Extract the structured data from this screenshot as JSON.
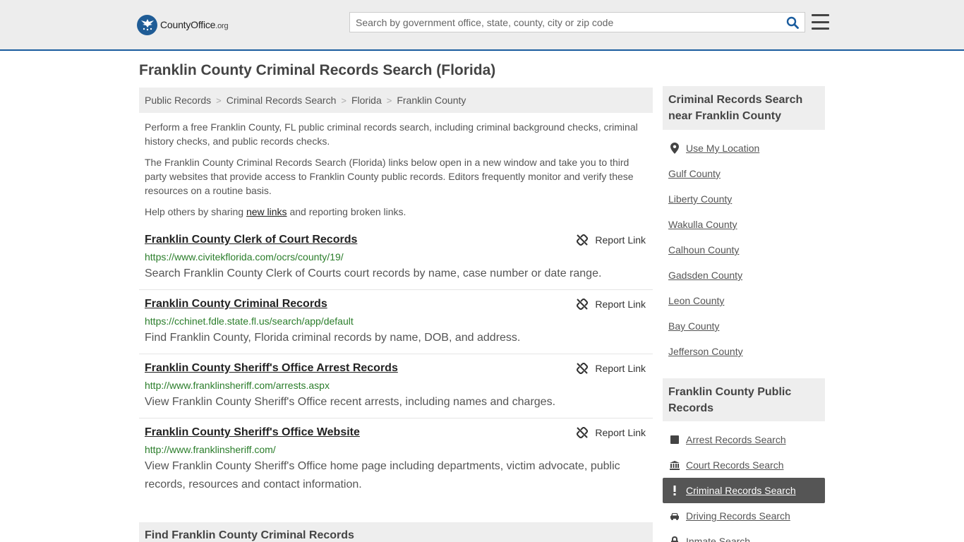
{
  "header": {
    "logo_main": "CountyOffice",
    "logo_tld": ".org",
    "search_placeholder": "Search by government office, state, county, city or zip code"
  },
  "page_title": "Franklin County Criminal Records Search (Florida)",
  "breadcrumb": [
    "Public Records",
    "Criminal Records Search",
    "Florida",
    "Franklin County"
  ],
  "intro": {
    "p1": "Perform a free Franklin County, FL public criminal records search, including criminal background checks, criminal history checks, and public records checks.",
    "p2": "The Franklin County Criminal Records Search (Florida) links below open in a new window and take you to third party websites that provide access to Franklin County public records. Editors frequently monitor and verify these resources on a routine basis.",
    "p3_before": "Help others by sharing ",
    "p3_link": "new links",
    "p3_after": " and reporting broken links."
  },
  "report_label": "Report Link",
  "links": [
    {
      "title": "Franklin County Clerk of Court Records",
      "url": "https://www.civitekflorida.com/ocrs/county/19/",
      "desc": "Search Franklin County Clerk of Courts court records by name, case number or date range."
    },
    {
      "title": "Franklin County Criminal Records",
      "url": "https://cchinet.fdle.state.fl.us/search/app/default",
      "desc": "Find Franklin County, Florida criminal records by name, DOB, and address."
    },
    {
      "title": "Franklin County Sheriff's Office Arrest Records",
      "url": "http://www.franklinsheriff.com/arrests.aspx",
      "desc": "View Franklin County Sheriff's Office recent arrests, including names and charges."
    },
    {
      "title": "Franklin County Sheriff's Office Website",
      "url": "http://www.franklinsheriff.com/",
      "desc": "View Franklin County Sheriff's Office home page including departments, victim advocate, public records, resources and contact information."
    }
  ],
  "find_heading": "Find Franklin County Criminal Records",
  "sidebar": {
    "nearby_heading": "Criminal Records Search near Franklin County",
    "use_location": "Use My Location",
    "nearby": [
      "Gulf County",
      "Liberty County",
      "Wakulla County",
      "Calhoun County",
      "Gadsden County",
      "Leon County",
      "Bay County",
      "Jefferson County"
    ],
    "public_heading": "Franklin County Public Records",
    "public": [
      {
        "label": "Arrest Records Search",
        "icon": "square-icon"
      },
      {
        "label": "Court Records Search",
        "icon": "courthouse-icon"
      },
      {
        "label": "Criminal Records Search",
        "icon": "exclamation-icon"
      },
      {
        "label": "Driving Records Search",
        "icon": "car-icon"
      },
      {
        "label": "Inmate Search",
        "icon": "lock-icon"
      }
    ]
  }
}
